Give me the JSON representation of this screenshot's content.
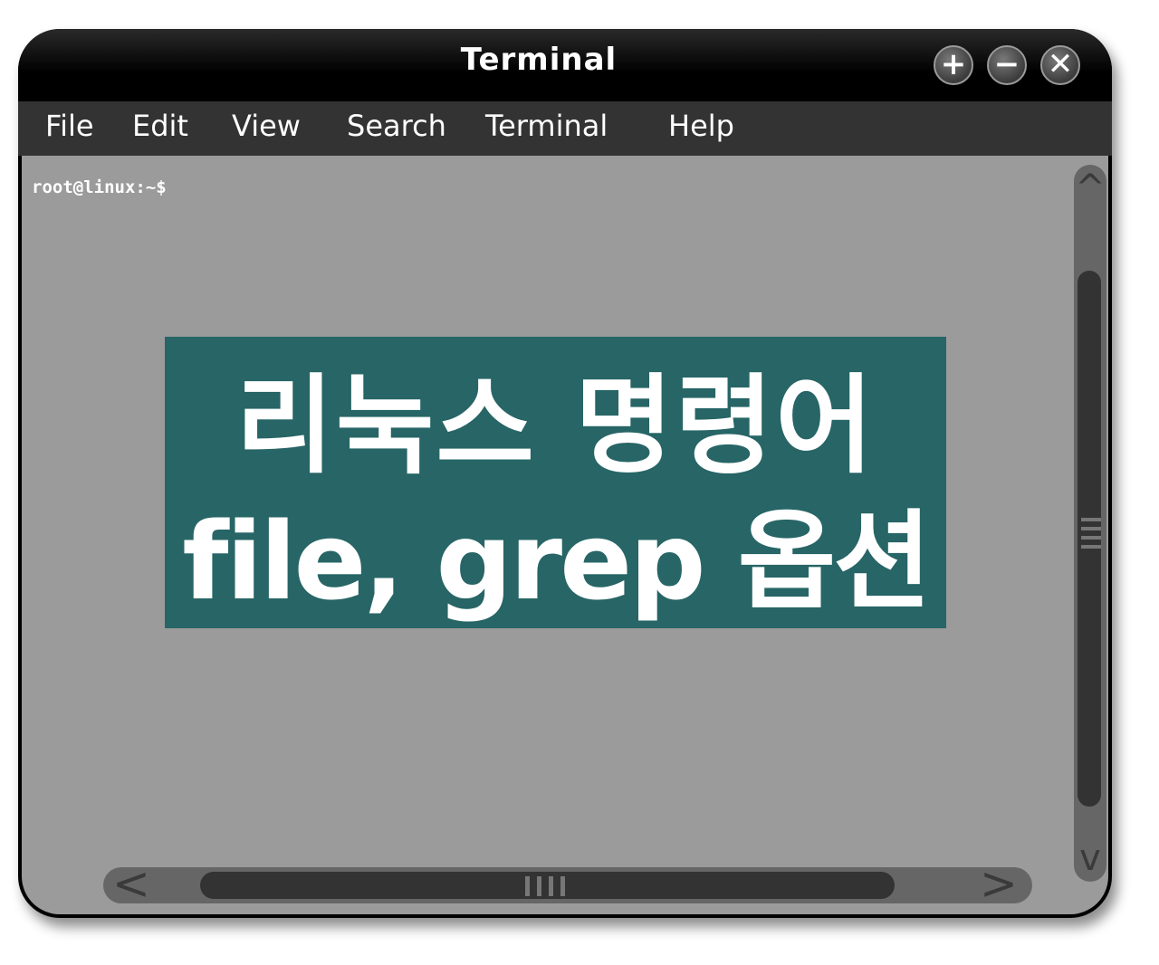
{
  "window": {
    "title": "Terminal",
    "buttons": {
      "add": "+",
      "minimize": "−",
      "close": "✕"
    }
  },
  "menu": {
    "items": [
      {
        "label": "File"
      },
      {
        "label": "Edit"
      },
      {
        "label": "View"
      },
      {
        "label": "Search"
      },
      {
        "label": "Terminal"
      },
      {
        "label": "Help"
      }
    ]
  },
  "terminal": {
    "prompt": "root@linux:~$"
  },
  "banner": {
    "line1": "리눅스 명령어",
    "line2": "file, grep 옵션"
  },
  "scrollbars": {
    "vertical": {
      "up_arrow": "^",
      "down_arrow": "v"
    },
    "horizontal": {
      "left_arrow": "<",
      "right_arrow": ">"
    }
  },
  "colors": {
    "titlebar": "#000000",
    "menubar": "#333333",
    "terminal_bg": "#9b9b9b",
    "banner_bg": "#276566",
    "text": "#ffffff"
  }
}
